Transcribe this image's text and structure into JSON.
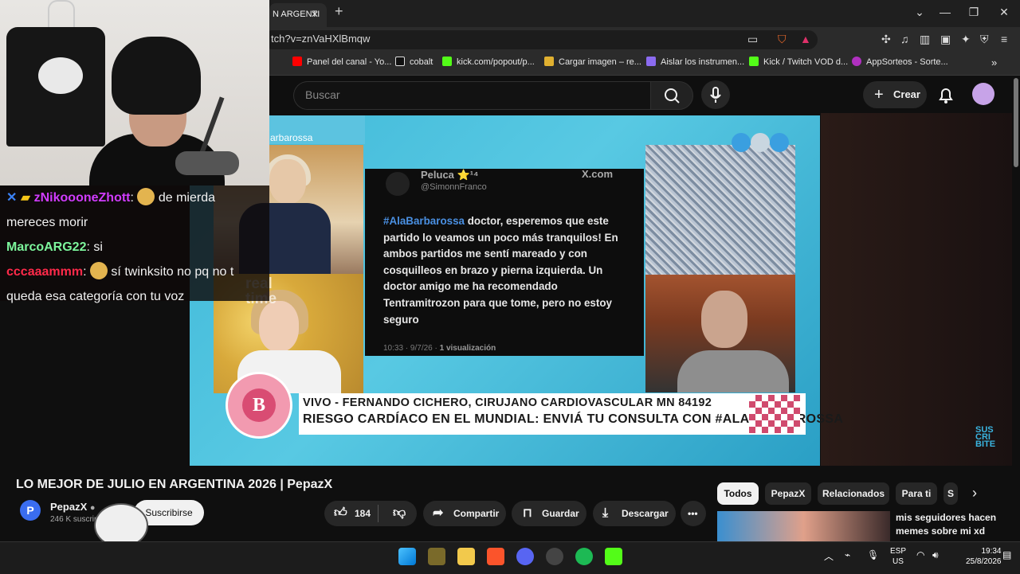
{
  "browser": {
    "tab_title": "N ARGENTI",
    "url": "tch?v=znVaHXlBmqw",
    "bookmarks": [
      {
        "label": "Panel del canal - Yo...",
        "color": "#ff0000"
      },
      {
        "label": "cobalt",
        "color": "#ffffff"
      },
      {
        "label": "kick.com/popout/p...",
        "color": "#53fc18"
      },
      {
        "label": "Cargar imagen – re...",
        "color": "#e0b030"
      },
      {
        "label": "Aislar los instrumen...",
        "color": "#8b6bf0"
      },
      {
        "label": "Kick / Twitch VOD d...",
        "color": "#53fc18"
      },
      {
        "label": "AppSorteos - Sorte...",
        "color": "#b030c0"
      }
    ]
  },
  "youtube": {
    "search_placeholder": "Buscar",
    "create_label": "Crear",
    "video_title": "LO MEJOR DE JULIO EN ARGENTINA 2026 | PepazX",
    "channel_name": "PepazX",
    "channel_initial": "P",
    "subscriber_count": "246 K suscriptores",
    "subscribe_label": "Suscribirse",
    "likes": "184",
    "share_label": "Compartir",
    "save_label": "Guardar",
    "download_label": "Descargar",
    "chips": [
      "Todos",
      "PepazX",
      "Relacionados",
      "Para ti",
      "S"
    ],
    "rec_title_line1": "mis seguidores hacen",
    "rec_title_line2": "memes sobre mi xd"
  },
  "video": {
    "brand_tag": "arbarossa",
    "tweet": {
      "name": "Peluca ⭐¹⁴",
      "handle": "@SimonnFranco",
      "site": "X.com",
      "hashtag": "#AlaBarbarossa",
      "body": " doctor, esperemos que este partido lo veamos un poco más tranquilos! En ambos partidos me sentí mareado y con cosquilleos en brazo y pierna izquierda. Un doctor amigo me ha recomendado Tentramitrozon para que tome, pero no estoy seguro",
      "time": "10:33 · 9/7/26 · ",
      "views": "1 visualización"
    },
    "realtime_line1": "real",
    "realtime_line2": "time",
    "lower_third_1": "VIVO - FERNANDO CICHERO, CIRUJANO CARDIOVASCULAR MN 84192",
    "lower_third_2": "RIESGO CARDÍACO EN EL MUNDIAL: ENVIÁ TU CONSULTA CON #ALABARBAROSSA",
    "logo_letter": "B",
    "subscribe_watermark": [
      "SUS",
      "CRI",
      "BITE"
    ]
  },
  "chat": [
    {
      "user": "zNikoooneZhott",
      "color": "#d13cff",
      "text": " de mierda mereces morir",
      "emote": true
    },
    {
      "user": "MarcoARG22",
      "color": "#7cf59c",
      "text": ": si",
      "emote": false
    },
    {
      "user": "cccaaammm",
      "color": "#ff2a4a",
      "text": " sí twinksito no pq no t queda esa categoría con tu voz",
      "emote": true
    }
  ],
  "taskbar": {
    "lang_line1": "ESP",
    "lang_line2": "US",
    "time": "19:34",
    "date": "25/8/2026"
  }
}
